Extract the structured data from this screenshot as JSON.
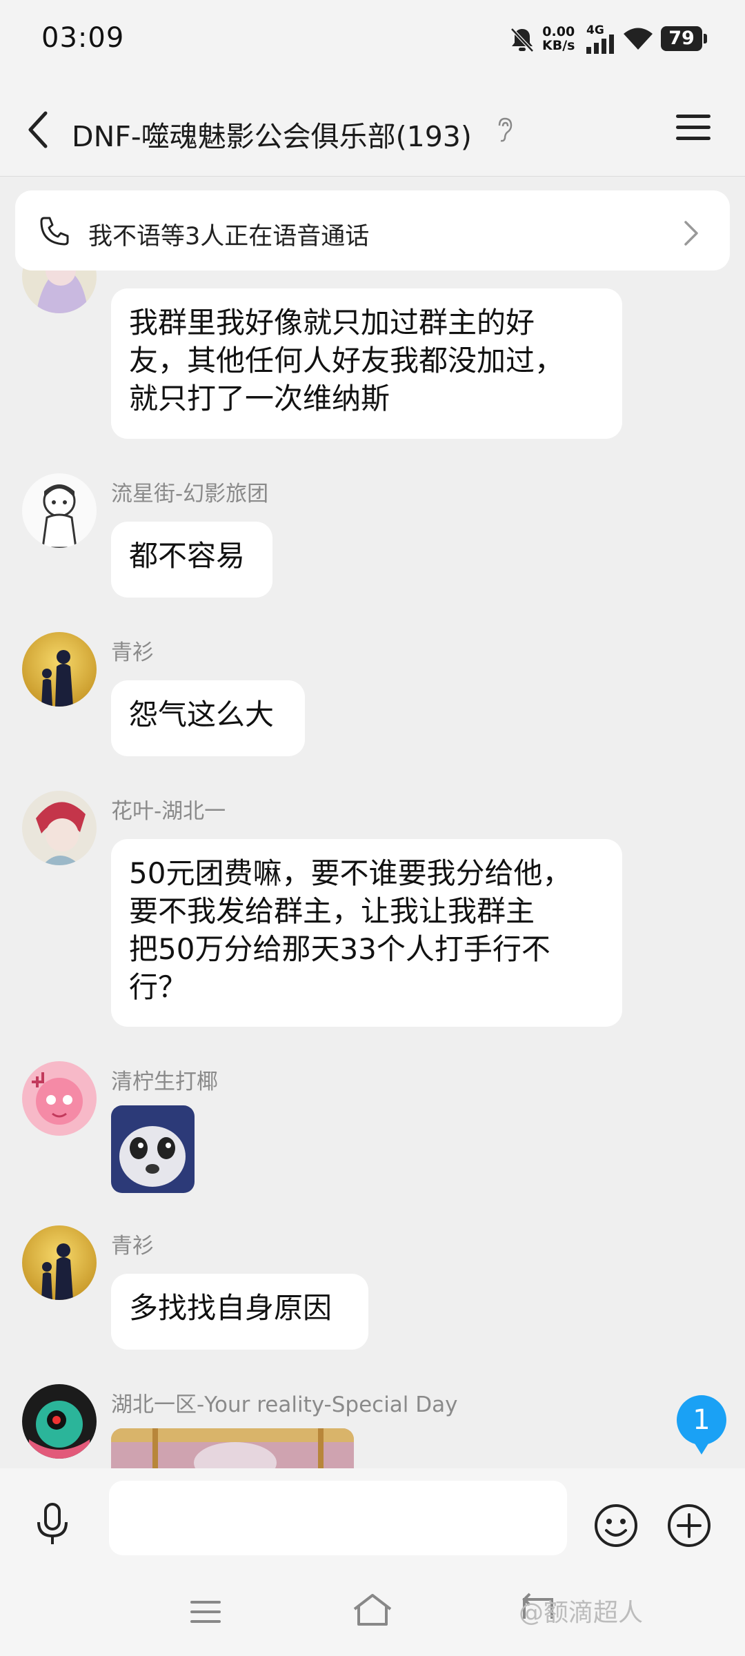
{
  "status_bar": {
    "time": "03:09",
    "net_speed_value": "0.00",
    "net_speed_unit": "KB/s",
    "network_type": "4G",
    "battery": "79"
  },
  "header": {
    "title": "DNF-噬魂魅影公会俱乐部(193)"
  },
  "call_banner": {
    "text": "我不语等3人正在语音通话"
  },
  "messages": [
    {
      "sender": "",
      "lines": [
        "我群里我好像就只加过群主的好",
        "友，其他任何人好友我都没加过，",
        "就只打了一次维纳斯"
      ]
    },
    {
      "sender": "流星街-幻影旅团",
      "lines": [
        "都不容易"
      ]
    },
    {
      "sender": "青衫",
      "lines": [
        "怨气这么大"
      ]
    },
    {
      "sender": "花叶-湖北一",
      "lines": [
        "50元团费嘛，要不谁要我分给他，",
        "要不我发给群主，让我让我群主",
        "把50万分给那天33个人打手行不",
        "行？"
      ]
    },
    {
      "sender": "清柠生打椰",
      "sticker": "panda-meme"
    },
    {
      "sender": "青衫",
      "lines": [
        "多找找自身原因"
      ]
    },
    {
      "sender": "湖北一区-Your reality-Special Day",
      "image": "photo"
    }
  ],
  "unread_badge": "1",
  "input": {
    "placeholder": ""
  },
  "watermark": "@额滴超人",
  "colors": {
    "accent": "#1aa1f5",
    "background": "#efefef",
    "bubble": "#ffffff"
  }
}
